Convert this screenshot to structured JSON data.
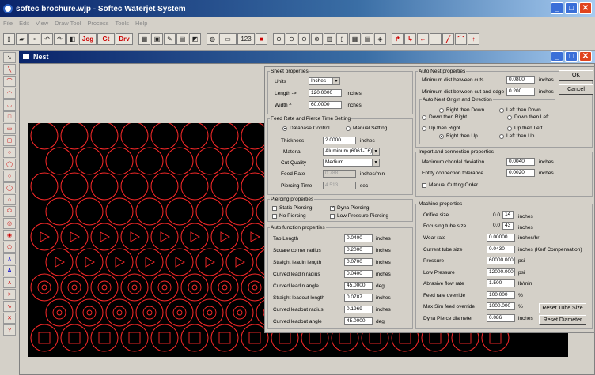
{
  "window": {
    "title": "softec brochure.wjp - Softec Waterjet System"
  },
  "menu": [
    "File",
    "Edit",
    "View",
    "Draw Tool",
    "Process",
    "Tools",
    "Help"
  ],
  "toolbar": {
    "t1": "Jog",
    "t2": "Gt",
    "t3": "Drv",
    "counter": "123"
  },
  "nest": {
    "title": "Nest"
  },
  "dialog": {
    "ok": "OK",
    "cancel": "Cancel",
    "sheet": {
      "legend": "Sheet properties",
      "units_label": "Units",
      "units_value": "Inches",
      "length_label": "Length ->",
      "length_value": "120.0000",
      "length_unit": "inches",
      "width_label": "Width ^",
      "width_value": "60.0000",
      "width_unit": "inches"
    },
    "feed": {
      "legend": "Feed Rate and Pierce Time Setting",
      "db_control": "Database Control",
      "manual_setting": "Manual Setting",
      "thickness_label": "Thickness",
      "thickness_value": "2.0000",
      "thickness_unit": "inches",
      "material_label": "Material",
      "material_value": "Aluminum (6061-T6)",
      "quality_label": "Cut Quality",
      "quality_value": "Medium",
      "feedrate_label": "Feed Rate",
      "feedrate_value": "0.788",
      "feedrate_unit": "inches/min",
      "pierce_label": "Piercing Time",
      "pierce_value": "4.513",
      "pierce_unit": "sec"
    },
    "piercing": {
      "legend": "Piercing properties",
      "static": "Static Piercing",
      "dyna": "Dyna Piercing",
      "none": "No Piercing",
      "low": "Low Pressure Piercing"
    },
    "autofn": {
      "legend": "Auto function properties",
      "rows": [
        {
          "label": "Tab Length",
          "value": "0.0400",
          "unit": "inches"
        },
        {
          "label": "Square corner radius",
          "value": "0.2000",
          "unit": "inches"
        },
        {
          "label": "Straight leadin length",
          "value": "0.0700",
          "unit": "inches"
        },
        {
          "label": "Curved leadin radius",
          "value": "0.0400",
          "unit": "inches"
        },
        {
          "label": "Curved leadin angle",
          "value": "45.0000",
          "unit": "deg"
        },
        {
          "label": "Straight leadout length",
          "value": "0.0787",
          "unit": "inches"
        },
        {
          "label": "Curved leadout radius",
          "value": "0.1969",
          "unit": "inches"
        },
        {
          "label": "Curved leadout angle",
          "value": "45.0000",
          "unit": "deg"
        }
      ]
    },
    "autonest": {
      "legend": "Auto Nest properties",
      "min_cuts_label": "Minimum dist between cuts",
      "min_cuts_value": "0.0800",
      "min_cuts_unit": "inches",
      "min_edge_label": "Minimum dist between cut and edge",
      "min_edge_value": "0.200",
      "min_edge_unit": "inches",
      "origin_legend": "Auto Nest Origin and Direction",
      "o1": "Right then Down",
      "o2": "Left then Down",
      "o3": "Down then Right",
      "o4": "Down then Left",
      "o5": "Up then Right",
      "o6": "Up then Left",
      "o7": "Right then Up",
      "o8": "Left then Up"
    },
    "import": {
      "legend": "Import and connection properties",
      "chordal_label": "Maximum chordal deviation",
      "chordal_value": "0.0040",
      "chordal_unit": "inches",
      "entity_label": "Entity connection tolerance",
      "entity_value": "0.0020",
      "entity_unit": "inches",
      "manual_order": "Manual Cutting Order"
    },
    "machine": {
      "legend": "Machine properties",
      "orifice_label": "Orifice size",
      "orifice_prefix": "0.0",
      "orifice_value": "14",
      "orifice_unit": "inches",
      "tube_label": "Focusing tube size",
      "tube_prefix": "0.0",
      "tube_value": "43",
      "tube_unit": "inches",
      "rows": [
        {
          "label": "Wear rate",
          "value": "0.00000",
          "unit": "inches/hr"
        },
        {
          "label": "Current tube size",
          "value": "0.0430",
          "unit": "inches (Kerf Compensation)"
        },
        {
          "label": "Pressure",
          "value": "60000.000",
          "unit": "psi"
        },
        {
          "label": "Low Pressure",
          "value": "12000.000",
          "unit": "psi"
        },
        {
          "label": "Abrasive flow rate",
          "value": "1.500",
          "unit": "lb/min"
        },
        {
          "label": "Feed rate override",
          "value": "100.000",
          "unit": "%"
        },
        {
          "label": "Max Sim feed override",
          "value": "1000.000",
          "unit": "%"
        },
        {
          "label": "Dyna Pierce diameter",
          "value": "0.086",
          "unit": "inches"
        }
      ],
      "reset_tube": "Reset Tube Size",
      "reset_diameter": "Reset Diameter"
    }
  },
  "colors": {
    "part_outline": "#ff2a2a",
    "sheet": "#000000",
    "titlebar": "#0a246a"
  }
}
